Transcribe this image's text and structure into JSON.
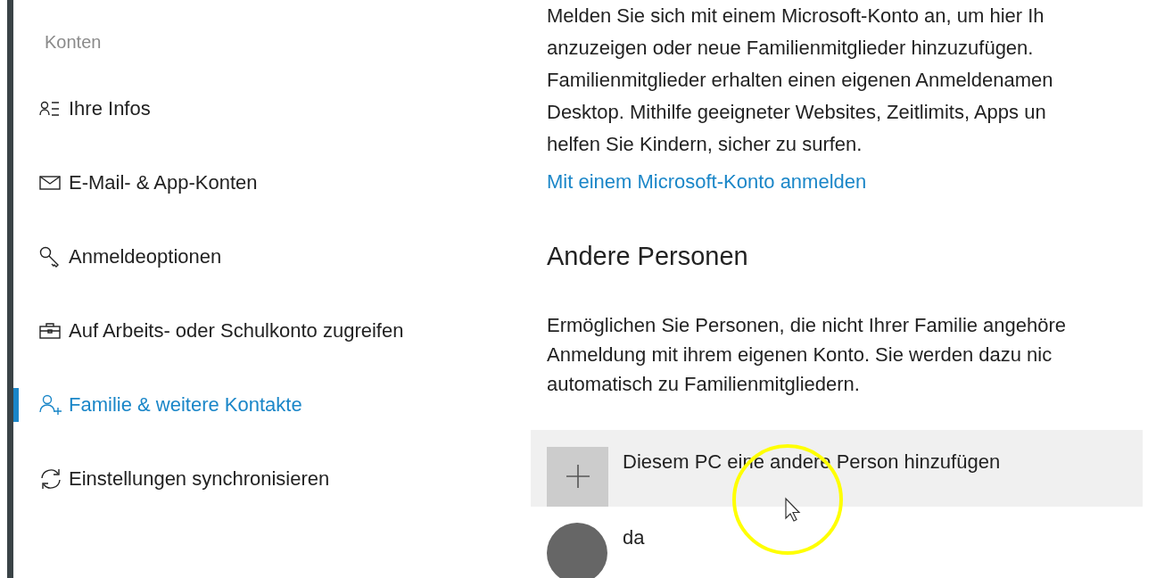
{
  "sidebar": {
    "title": "Konten",
    "items": [
      {
        "label": "Ihre Infos",
        "selected": false
      },
      {
        "label": "E-Mail- & App-Konten",
        "selected": false
      },
      {
        "label": "Anmeldeoptionen",
        "selected": false
      },
      {
        "label": "Auf Arbeits- oder Schulkonto zugreifen",
        "selected": false
      },
      {
        "label": "Familie & weitere Kontakte",
        "selected": true
      },
      {
        "label": "Einstellungen synchronisieren",
        "selected": false
      }
    ]
  },
  "family": {
    "lines": [
      "Melden Sie sich mit einem Microsoft-Konto an, um hier Ih",
      "anzuzeigen oder neue Familienmitglieder hinzuzufügen.",
      "Familienmitglieder erhalten einen eigenen Anmeldenamen",
      "Desktop. Mithilfe geeigneter Websites, Zeitlimits, Apps un",
      "helfen Sie Kindern, sicher zu surfen."
    ],
    "link": "Mit einem Microsoft-Konto anmelden"
  },
  "other": {
    "heading": "Andere Personen",
    "lines": [
      "Ermöglichen Sie Personen, die nicht Ihrer Familie angehöre",
      "Anmeldung mit ihrem eigenen Konto. Sie werden dazu nic",
      "automatisch zu Familienmitgliedern."
    ],
    "add_button": "Diesem PC eine andere Person hinzufügen",
    "users": [
      {
        "name": "da"
      }
    ]
  }
}
